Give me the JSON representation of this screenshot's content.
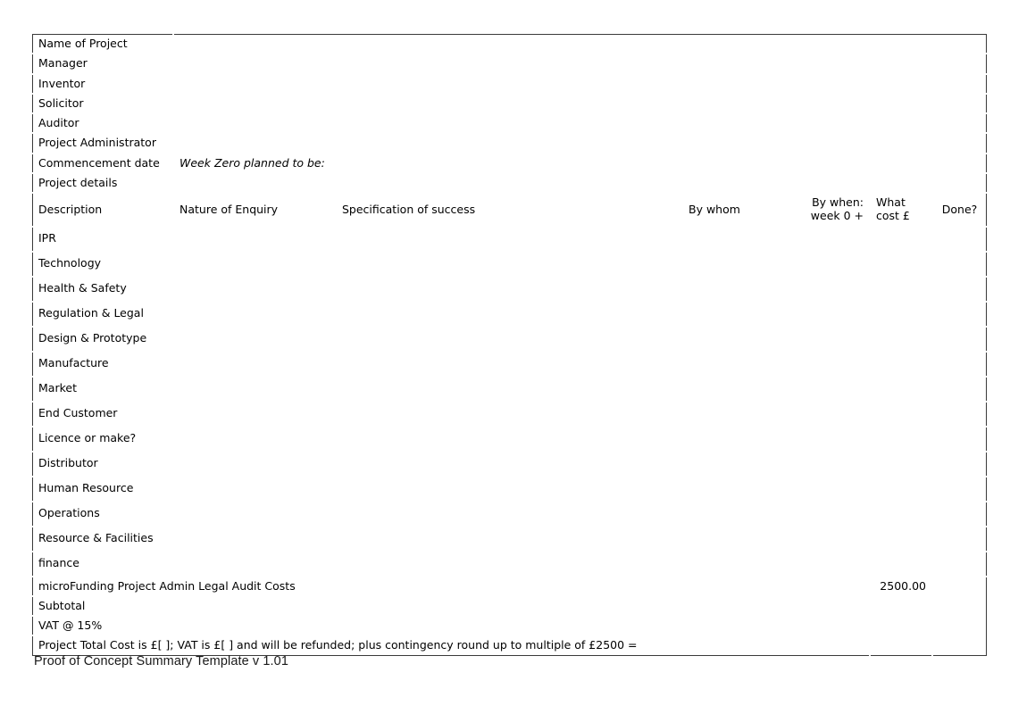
{
  "document": {
    "caption": "Proof of Concept Summary Template v 1.01"
  },
  "info_fields": [
    {
      "label": "Name of Project",
      "value": ""
    },
    {
      "label": "Manager",
      "value": ""
    },
    {
      "label": "Inventor",
      "value": ""
    },
    {
      "label": "Solicitor",
      "value": ""
    },
    {
      "label": "Auditor",
      "value": ""
    },
    {
      "label": "Project Administrator",
      "value": ""
    },
    {
      "label": "Commencement date",
      "value": "Week Zero planned to be:"
    },
    {
      "label": "Project details",
      "value": ""
    }
  ],
  "columns": {
    "description": "Description",
    "nature": "Nature of Enquiry",
    "specification": "Specification of success",
    "by_whom": "By whom",
    "by_when_line1": "By when:",
    "by_when_line2": "week 0 +",
    "what_cost_line1": "What",
    "what_cost_line2": "cost £",
    "done": "Done?"
  },
  "rows": [
    {
      "label": "IPR",
      "nature": "",
      "specification": "",
      "by_whom": "",
      "by_when": "",
      "cost": "",
      "done": ""
    },
    {
      "label": "Technology",
      "nature": "",
      "specification": "",
      "by_whom": "",
      "by_when": "",
      "cost": "",
      "done": ""
    },
    {
      "label": "Health & Safety",
      "nature": "",
      "specification": "",
      "by_whom": "",
      "by_when": "",
      "cost": "",
      "done": ""
    },
    {
      "label": "Regulation & Legal",
      "nature": "",
      "specification": "",
      "by_whom": "",
      "by_when": "",
      "cost": "",
      "done": ""
    },
    {
      "label": "Design & Prototype",
      "nature": "",
      "specification": "",
      "by_whom": "",
      "by_when": "",
      "cost": "",
      "done": ""
    },
    {
      "label": "Manufacture",
      "nature": "",
      "specification": "",
      "by_whom": "",
      "by_when": "",
      "cost": "",
      "done": ""
    },
    {
      "label": "Market",
      "nature": "",
      "specification": "",
      "by_whom": "",
      "by_when": "",
      "cost": "",
      "done": ""
    },
    {
      "label": "End Customer",
      "nature": "",
      "specification": "",
      "by_whom": "",
      "by_when": "",
      "cost": "",
      "done": ""
    },
    {
      "label": "Licence or make?",
      "nature": "",
      "specification": "",
      "by_whom": "",
      "by_when": "",
      "cost": "",
      "done": ""
    },
    {
      "label": "Distributor",
      "nature": "",
      "specification": "",
      "by_whom": "",
      "by_when": "",
      "cost": "",
      "done": ""
    },
    {
      "label": "Human Resource",
      "nature": "",
      "specification": "",
      "by_whom": "",
      "by_when": "",
      "cost": "",
      "done": ""
    },
    {
      "label": "Operations",
      "nature": "",
      "specification": "",
      "by_whom": "",
      "by_when": "",
      "cost": "",
      "done": ""
    },
    {
      "label": "Resource & Facilities",
      "nature": "",
      "specification": "",
      "by_whom": "",
      "by_when": "",
      "cost": "",
      "done": ""
    },
    {
      "label": "finance",
      "nature": "",
      "specification": "",
      "by_whom": "",
      "by_when": "",
      "cost": "",
      "done": ""
    }
  ],
  "totals": [
    {
      "label": "microFunding Project Admin Legal Audit Costs",
      "cost": "2500.00"
    },
    {
      "label": "Subtotal",
      "cost": ""
    },
    {
      "label": "VAT @ 15%",
      "cost": ""
    },
    {
      "label": "Project Total Cost is £[   ]; VAT is £[   ] and will be refunded; plus contingency round up to multiple of £2500 =",
      "cost": ""
    }
  ],
  "totals_done_cell": ""
}
